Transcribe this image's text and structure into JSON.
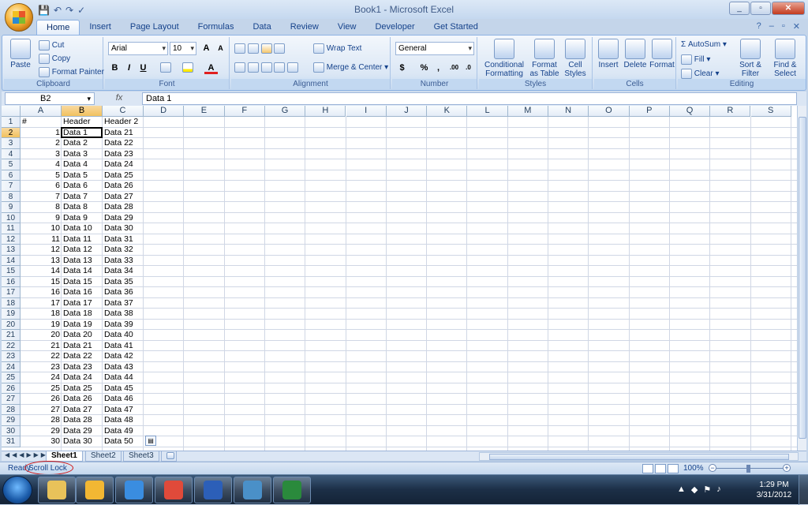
{
  "window": {
    "title": "Book1 - Microsoft Excel",
    "minimize": "_",
    "maximize": "▫",
    "close": "✕"
  },
  "qat": {
    "save": "💾",
    "undo": "↶",
    "redo": "↷",
    "spelling": "✓"
  },
  "tabs": [
    {
      "label": "Home",
      "active": true
    },
    {
      "label": "Insert"
    },
    {
      "label": "Page Layout"
    },
    {
      "label": "Formulas"
    },
    {
      "label": "Data"
    },
    {
      "label": "Review"
    },
    {
      "label": "View"
    },
    {
      "label": "Developer"
    },
    {
      "label": "Get Started"
    }
  ],
  "help": {
    "help": "?",
    "min": "–",
    "restore": "▫",
    "close": "✕"
  },
  "ribbon": {
    "clipboard": {
      "label": "Clipboard",
      "paste": "Paste",
      "cut": "Cut",
      "copy": "Copy",
      "format_painter": "Format Painter"
    },
    "font": {
      "label": "Font",
      "family": "Arial",
      "size": "10",
      "grow": "A",
      "shrink": "A",
      "bold": "B",
      "italic": "I",
      "underline": "U",
      "font_color": "A"
    },
    "alignment": {
      "label": "Alignment",
      "wrap": "Wrap Text",
      "merge": "Merge & Center"
    },
    "number": {
      "label": "Number",
      "format": "General",
      "currency": "$",
      "percent": "%",
      "comma": ",",
      "inc_dec": ".00",
      "dec_dec": ".0"
    },
    "styles": {
      "label": "Styles",
      "conditional_1": "Conditional",
      "conditional_2": "Formatting",
      "format_table_1": "Format",
      "format_table_2": "as Table",
      "cell_styles_1": "Cell",
      "cell_styles_2": "Styles"
    },
    "cells": {
      "label": "Cells",
      "insert": "Insert",
      "delete": "Delete",
      "format": "Format"
    },
    "editing": {
      "label": "Editing",
      "autosum": "AutoSum",
      "fill": "Fill",
      "clear": "Clear",
      "sort_1": "Sort &",
      "sort_2": "Filter",
      "find_1": "Find &",
      "find_2": "Select"
    }
  },
  "formula_bar": {
    "name_box": "B2",
    "fx": "fx",
    "content": "Data 1"
  },
  "sheet": {
    "columns": [
      "A",
      "B",
      "C",
      "D",
      "E",
      "F",
      "G",
      "H",
      "I",
      "J",
      "K",
      "L",
      "M",
      "N",
      "O",
      "P",
      "Q",
      "R",
      "S"
    ],
    "selected_column": "B",
    "selected_row": 2,
    "header_row": {
      "a": "#",
      "b": "Header",
      "c": "Header 2"
    },
    "rows": [
      {
        "n": "1",
        "b": "Data 1",
        "c": "Data 21"
      },
      {
        "n": "2",
        "b": "Data 2",
        "c": "Data 22"
      },
      {
        "n": "3",
        "b": "Data 3",
        "c": "Data 23"
      },
      {
        "n": "4",
        "b": "Data 4",
        "c": "Data 24"
      },
      {
        "n": "5",
        "b": "Data 5",
        "c": "Data 25"
      },
      {
        "n": "6",
        "b": "Data 6",
        "c": "Data 26"
      },
      {
        "n": "7",
        "b": "Data 7",
        "c": "Data 27"
      },
      {
        "n": "8",
        "b": "Data 8",
        "c": "Data 28"
      },
      {
        "n": "9",
        "b": "Data 9",
        "c": "Data 29"
      },
      {
        "n": "10",
        "b": "Data 10",
        "c": "Data 30"
      },
      {
        "n": "11",
        "b": "Data 11",
        "c": "Data 31"
      },
      {
        "n": "12",
        "b": "Data 12",
        "c": "Data 32"
      },
      {
        "n": "13",
        "b": "Data 13",
        "c": "Data 33"
      },
      {
        "n": "14",
        "b": "Data 14",
        "c": "Data 34"
      },
      {
        "n": "15",
        "b": "Data 15",
        "c": "Data 35"
      },
      {
        "n": "16",
        "b": "Data 16",
        "c": "Data 36"
      },
      {
        "n": "17",
        "b": "Data 17",
        "c": "Data 37"
      },
      {
        "n": "18",
        "b": "Data 18",
        "c": "Data 38"
      },
      {
        "n": "19",
        "b": "Data 19",
        "c": "Data 39"
      },
      {
        "n": "20",
        "b": "Data 20",
        "c": "Data 40"
      },
      {
        "n": "21",
        "b": "Data 21",
        "c": "Data 41"
      },
      {
        "n": "22",
        "b": "Data 22",
        "c": "Data 42"
      },
      {
        "n": "23",
        "b": "Data 23",
        "c": "Data 43"
      },
      {
        "n": "24",
        "b": "Data 24",
        "c": "Data 44"
      },
      {
        "n": "25",
        "b": "Data 25",
        "c": "Data 45"
      },
      {
        "n": "26",
        "b": "Data 26",
        "c": "Data 46"
      },
      {
        "n": "27",
        "b": "Data 27",
        "c": "Data 47"
      },
      {
        "n": "28",
        "b": "Data 28",
        "c": "Data 48"
      },
      {
        "n": "29",
        "b": "Data 29",
        "c": "Data 49"
      },
      {
        "n": "30",
        "b": "Data 30",
        "c": "Data 50"
      }
    ]
  },
  "sheet_tabs": [
    {
      "label": "Sheet1",
      "active": true
    },
    {
      "label": "Sheet2"
    },
    {
      "label": "Sheet3"
    }
  ],
  "status": {
    "ready": "Ready",
    "scroll_lock": "Scroll Lock",
    "zoom": "100%",
    "annotation_color": "#d21a1a"
  },
  "taskbar": {
    "items": [
      {
        "icon": "explorer-icon",
        "color": "#e8c25a"
      },
      {
        "icon": "outlook-icon",
        "color": "#f2b733"
      },
      {
        "icon": "ie-icon",
        "color": "#3a8de0"
      },
      {
        "icon": "chrome-icon",
        "color": "#e04a3a"
      },
      {
        "icon": "word-icon",
        "color": "#2c5fb8"
      },
      {
        "icon": "remote-desktop-icon",
        "color": "#4a90c8"
      },
      {
        "icon": "excel-icon",
        "color": "#2a8a3c"
      }
    ],
    "time": "1:29 PM",
    "date": "3/31/2012"
  }
}
